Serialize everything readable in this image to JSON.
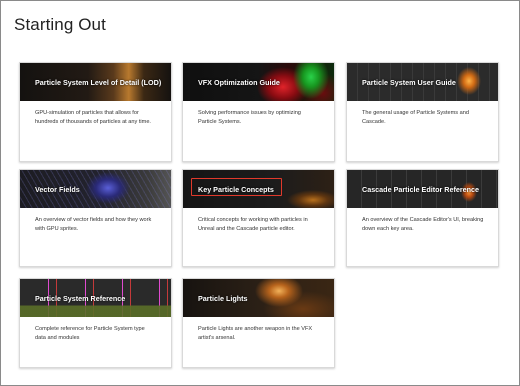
{
  "page": {
    "title": "Starting Out"
  },
  "cards": [
    {
      "title": "Particle System Level of Detail (LOD)",
      "description": "GPU-simulation of particles that allows for hundreds of thousands of particles at any time."
    },
    {
      "title": "VFX Optimization Guide",
      "description": "Solving performance issues by optimizing Particle Systems."
    },
    {
      "title": "Particle System User Guide",
      "description": "The general usage of Particle Systems and Cascade."
    },
    {
      "title": "Vector Fields",
      "description": "An overview of vector fields and how they work with GPU sprites."
    },
    {
      "title": "Key Particle Concepts",
      "description": "Critical concepts for working with particles in Unreal and the Cascade particle editor."
    },
    {
      "title": "Cascade Particle Editor Reference",
      "description": "An overview of the Cascade Editor's UI, breaking down each key area."
    },
    {
      "title": "Particle System Reference",
      "description": "Complete reference for Particle System type data and modules"
    },
    {
      "title": "Particle Lights",
      "description": "Particle Lights are another weapon in the VFX artist's arsenal."
    }
  ],
  "highlight": {
    "color": "#e0392b"
  }
}
